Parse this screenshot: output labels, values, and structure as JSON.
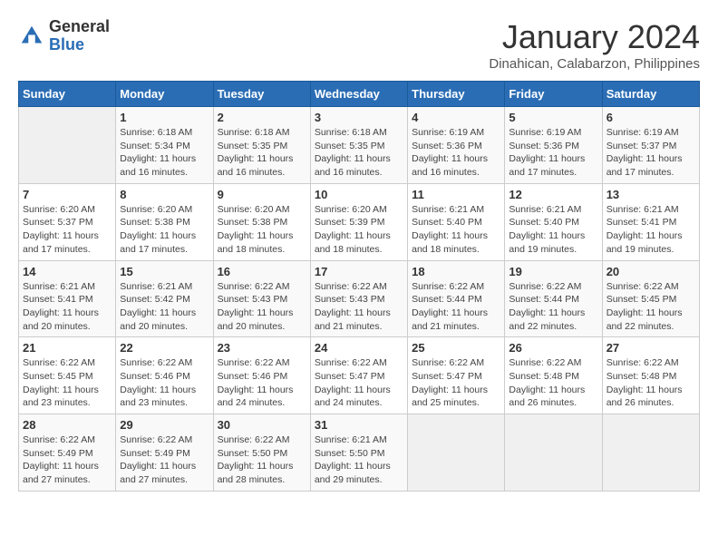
{
  "header": {
    "logo_general": "General",
    "logo_blue": "Blue",
    "month_title": "January 2024",
    "location": "Dinahican, Calabarzon, Philippines"
  },
  "weekdays": [
    "Sunday",
    "Monday",
    "Tuesday",
    "Wednesday",
    "Thursday",
    "Friday",
    "Saturday"
  ],
  "weeks": [
    [
      {
        "day": "",
        "sunrise": "",
        "sunset": "",
        "daylight": ""
      },
      {
        "day": "1",
        "sunrise": "Sunrise: 6:18 AM",
        "sunset": "Sunset: 5:34 PM",
        "daylight": "Daylight: 11 hours and 16 minutes."
      },
      {
        "day": "2",
        "sunrise": "Sunrise: 6:18 AM",
        "sunset": "Sunset: 5:35 PM",
        "daylight": "Daylight: 11 hours and 16 minutes."
      },
      {
        "day": "3",
        "sunrise": "Sunrise: 6:18 AM",
        "sunset": "Sunset: 5:35 PM",
        "daylight": "Daylight: 11 hours and 16 minutes."
      },
      {
        "day": "4",
        "sunrise": "Sunrise: 6:19 AM",
        "sunset": "Sunset: 5:36 PM",
        "daylight": "Daylight: 11 hours and 16 minutes."
      },
      {
        "day": "5",
        "sunrise": "Sunrise: 6:19 AM",
        "sunset": "Sunset: 5:36 PM",
        "daylight": "Daylight: 11 hours and 17 minutes."
      },
      {
        "day": "6",
        "sunrise": "Sunrise: 6:19 AM",
        "sunset": "Sunset: 5:37 PM",
        "daylight": "Daylight: 11 hours and 17 minutes."
      }
    ],
    [
      {
        "day": "7",
        "sunrise": "Sunrise: 6:20 AM",
        "sunset": "Sunset: 5:37 PM",
        "daylight": "Daylight: 11 hours and 17 minutes."
      },
      {
        "day": "8",
        "sunrise": "Sunrise: 6:20 AM",
        "sunset": "Sunset: 5:38 PM",
        "daylight": "Daylight: 11 hours and 17 minutes."
      },
      {
        "day": "9",
        "sunrise": "Sunrise: 6:20 AM",
        "sunset": "Sunset: 5:38 PM",
        "daylight": "Daylight: 11 hours and 18 minutes."
      },
      {
        "day": "10",
        "sunrise": "Sunrise: 6:20 AM",
        "sunset": "Sunset: 5:39 PM",
        "daylight": "Daylight: 11 hours and 18 minutes."
      },
      {
        "day": "11",
        "sunrise": "Sunrise: 6:21 AM",
        "sunset": "Sunset: 5:40 PM",
        "daylight": "Daylight: 11 hours and 18 minutes."
      },
      {
        "day": "12",
        "sunrise": "Sunrise: 6:21 AM",
        "sunset": "Sunset: 5:40 PM",
        "daylight": "Daylight: 11 hours and 19 minutes."
      },
      {
        "day": "13",
        "sunrise": "Sunrise: 6:21 AM",
        "sunset": "Sunset: 5:41 PM",
        "daylight": "Daylight: 11 hours and 19 minutes."
      }
    ],
    [
      {
        "day": "14",
        "sunrise": "Sunrise: 6:21 AM",
        "sunset": "Sunset: 5:41 PM",
        "daylight": "Daylight: 11 hours and 20 minutes."
      },
      {
        "day": "15",
        "sunrise": "Sunrise: 6:21 AM",
        "sunset": "Sunset: 5:42 PM",
        "daylight": "Daylight: 11 hours and 20 minutes."
      },
      {
        "day": "16",
        "sunrise": "Sunrise: 6:22 AM",
        "sunset": "Sunset: 5:43 PM",
        "daylight": "Daylight: 11 hours and 20 minutes."
      },
      {
        "day": "17",
        "sunrise": "Sunrise: 6:22 AM",
        "sunset": "Sunset: 5:43 PM",
        "daylight": "Daylight: 11 hours and 21 minutes."
      },
      {
        "day": "18",
        "sunrise": "Sunrise: 6:22 AM",
        "sunset": "Sunset: 5:44 PM",
        "daylight": "Daylight: 11 hours and 21 minutes."
      },
      {
        "day": "19",
        "sunrise": "Sunrise: 6:22 AM",
        "sunset": "Sunset: 5:44 PM",
        "daylight": "Daylight: 11 hours and 22 minutes."
      },
      {
        "day": "20",
        "sunrise": "Sunrise: 6:22 AM",
        "sunset": "Sunset: 5:45 PM",
        "daylight": "Daylight: 11 hours and 22 minutes."
      }
    ],
    [
      {
        "day": "21",
        "sunrise": "Sunrise: 6:22 AM",
        "sunset": "Sunset: 5:45 PM",
        "daylight": "Daylight: 11 hours and 23 minutes."
      },
      {
        "day": "22",
        "sunrise": "Sunrise: 6:22 AM",
        "sunset": "Sunset: 5:46 PM",
        "daylight": "Daylight: 11 hours and 23 minutes."
      },
      {
        "day": "23",
        "sunrise": "Sunrise: 6:22 AM",
        "sunset": "Sunset: 5:46 PM",
        "daylight": "Daylight: 11 hours and 24 minutes."
      },
      {
        "day": "24",
        "sunrise": "Sunrise: 6:22 AM",
        "sunset": "Sunset: 5:47 PM",
        "daylight": "Daylight: 11 hours and 24 minutes."
      },
      {
        "day": "25",
        "sunrise": "Sunrise: 6:22 AM",
        "sunset": "Sunset: 5:47 PM",
        "daylight": "Daylight: 11 hours and 25 minutes."
      },
      {
        "day": "26",
        "sunrise": "Sunrise: 6:22 AM",
        "sunset": "Sunset: 5:48 PM",
        "daylight": "Daylight: 11 hours and 26 minutes."
      },
      {
        "day": "27",
        "sunrise": "Sunrise: 6:22 AM",
        "sunset": "Sunset: 5:48 PM",
        "daylight": "Daylight: 11 hours and 26 minutes."
      }
    ],
    [
      {
        "day": "28",
        "sunrise": "Sunrise: 6:22 AM",
        "sunset": "Sunset: 5:49 PM",
        "daylight": "Daylight: 11 hours and 27 minutes."
      },
      {
        "day": "29",
        "sunrise": "Sunrise: 6:22 AM",
        "sunset": "Sunset: 5:49 PM",
        "daylight": "Daylight: 11 hours and 27 minutes."
      },
      {
        "day": "30",
        "sunrise": "Sunrise: 6:22 AM",
        "sunset": "Sunset: 5:50 PM",
        "daylight": "Daylight: 11 hours and 28 minutes."
      },
      {
        "day": "31",
        "sunrise": "Sunrise: 6:21 AM",
        "sunset": "Sunset: 5:50 PM",
        "daylight": "Daylight: 11 hours and 29 minutes."
      },
      {
        "day": "",
        "sunrise": "",
        "sunset": "",
        "daylight": ""
      },
      {
        "day": "",
        "sunrise": "",
        "sunset": "",
        "daylight": ""
      },
      {
        "day": "",
        "sunrise": "",
        "sunset": "",
        "daylight": ""
      }
    ]
  ]
}
